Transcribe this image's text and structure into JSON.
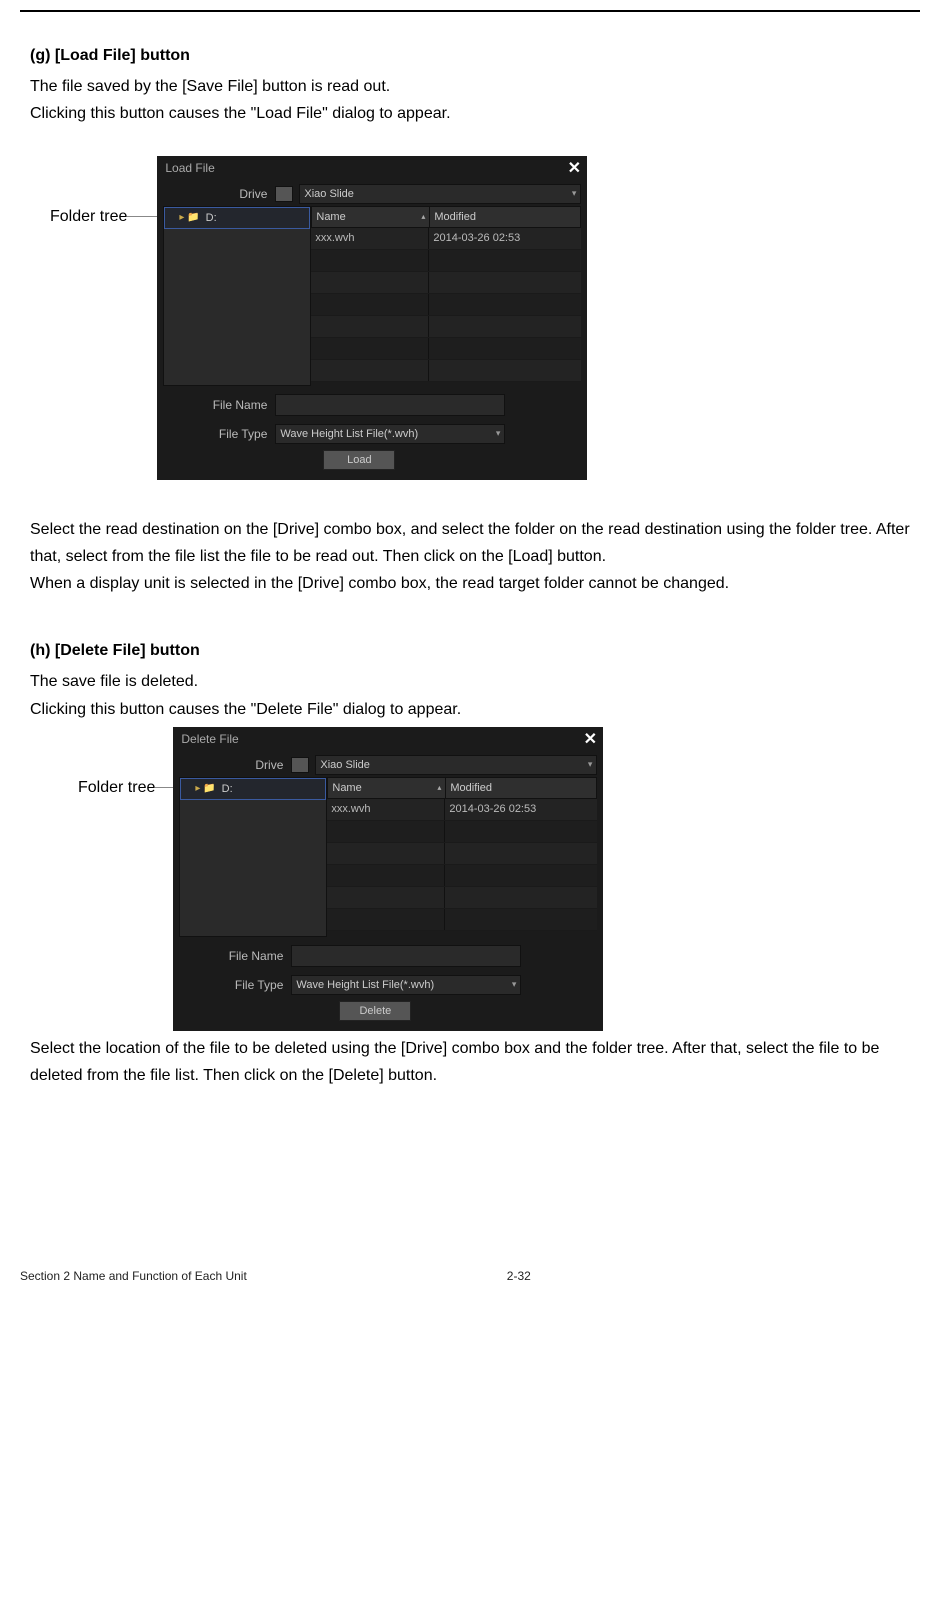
{
  "section_g": {
    "heading": "(g) [Load File] button",
    "desc1": "The file saved by the [Save File] button is read out.",
    "desc2": "Clicking this button causes the \"Load File\" dialog to appear.",
    "callout_label": "Folder tree",
    "post1": "Select the read destination on the [Drive] combo box, and select the folder on the read destination using the folder tree. After that, select from the file list the file to be read out. Then click on the [Load] button.",
    "post2": "When a display unit is selected in the [Drive] combo box, the read target folder cannot be changed."
  },
  "section_h": {
    "heading": "(h) [Delete File] button",
    "desc1": "The save file is deleted.",
    "desc2": "Clicking this button causes the \"Delete File\" dialog to appear.",
    "callout_label": "Folder tree",
    "post1": "Select the location of the file to be deleted using the [Drive] combo box and the folder tree. After that, select the file to be deleted from the file list. Then click on the [Delete] button."
  },
  "dialog_load": {
    "title": "Load File",
    "drive_label": "Drive",
    "drive_value": "Xiao Slide",
    "tree_item": "D:",
    "columns": {
      "name": "Name",
      "modified": "Modified"
    },
    "file_row": {
      "name": "xxx.wvh",
      "modified": "2014-03-26 02:53"
    },
    "filename_label": "File Name",
    "filename_value": "",
    "filetype_label": "File Type",
    "filetype_value": "Wave Height List File(*.wvh)",
    "button": "Load"
  },
  "dialog_delete": {
    "title": "Delete File",
    "drive_label": "Drive",
    "drive_value": "Xiao Slide",
    "tree_item": "D:",
    "columns": {
      "name": "Name",
      "modified": "Modified"
    },
    "file_row": {
      "name": "xxx.wvh",
      "modified": "2014-03-26 02:53"
    },
    "filename_label": "File Name",
    "filename_value": "",
    "filetype_label": "File Type",
    "filetype_value": "Wave Height List File(*.wvh)",
    "button": "Delete"
  },
  "footer": {
    "section": "Section 2   Name and Function of Each Unit",
    "page": "2-32"
  }
}
